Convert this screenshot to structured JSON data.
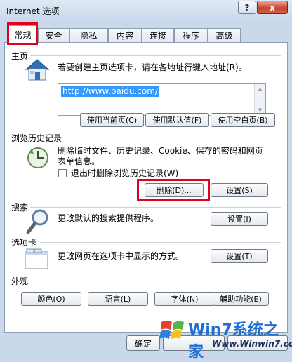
{
  "window": {
    "title": "Internet 选项",
    "help_glyph": "?",
    "close_glyph": "x"
  },
  "tabs": [
    {
      "label": "常规",
      "active": true
    },
    {
      "label": "安全"
    },
    {
      "label": "隐私"
    },
    {
      "label": "内容"
    },
    {
      "label": "连接"
    },
    {
      "label": "程序"
    },
    {
      "label": "高级"
    }
  ],
  "homepage": {
    "title": "主页",
    "description": "若要创建主页选项卡，请在各地址行键入地址(R)。",
    "url": "http://www.baidu.com/",
    "use_current_label": "使用当前页(C)",
    "use_default_label": "使用默认值(F)",
    "use_blank_label": "使用空白页(B)"
  },
  "history": {
    "title": "浏览历史记录",
    "description_line1": "删除临时文件、历史记录、Cookie、保存的密码和网页",
    "description_line2": "表单信息。",
    "checkbox_label": "退出时删除浏览历史记录(W)",
    "delete_label": "删除(D)...",
    "settings_label": "设置(S)"
  },
  "search": {
    "title": "搜索",
    "description": "更改默认的搜索提供程序。",
    "settings_label": "设置(I)"
  },
  "tabs_section": {
    "title": "选项卡",
    "description": "更改网页在选项卡中显示的方式。",
    "settings_label": "设置(T)"
  },
  "appearance": {
    "title": "外观",
    "colors_label": "颜色(O)",
    "languages_label": "语言(L)",
    "fonts_label": "字体(N)",
    "accessibility_label": "辅助功能(E)"
  },
  "footer": {
    "ok_label": "确定"
  },
  "watermark": {
    "brand": "Win7系统之家",
    "url": "Www.Winwin7.com"
  },
  "colors": {
    "highlight": "#e2001a",
    "selection": "#3399ff"
  }
}
